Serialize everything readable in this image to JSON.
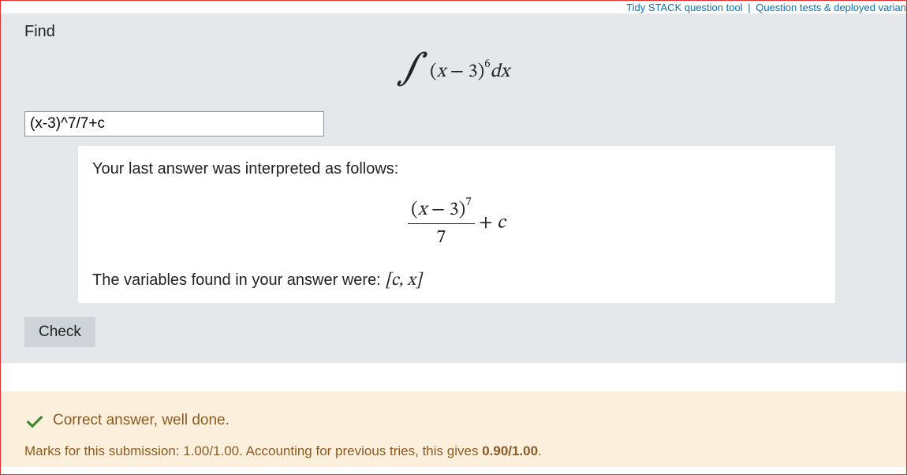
{
  "toplinks": {
    "tidy": "Tidy STACK question tool",
    "sep": "|",
    "tests": "Question tests & deployed varian"
  },
  "question": {
    "prompt": "Find",
    "integral": {
      "inner_open": "(",
      "var1": "x",
      "minus": " − ",
      "const": "3",
      "inner_close": ")",
      "exp": "6",
      "dvar": "dx"
    }
  },
  "answer": {
    "value": "(x-3)^7/7+c"
  },
  "feedback": {
    "intro": "Your last answer was interpreted as follows:",
    "frac": {
      "num_open": "(",
      "num_var": "x",
      "num_minus": " − ",
      "num_const": "3",
      "num_close": ")",
      "num_exp": "7",
      "den": "7"
    },
    "plus": " + ",
    "cvar": "c",
    "vars_intro": "The variables found in your answer were: ",
    "vars_list": "[c, x]"
  },
  "buttons": {
    "check": "Check"
  },
  "result": {
    "correct": "Correct answer, well done.",
    "marks_pre": "Marks for this submission: ",
    "marks_val": "1.00/1.00",
    "marks_mid": ". Accounting for previous tries, this gives ",
    "marks_final": "0.90/1.00",
    "marks_post": "."
  }
}
